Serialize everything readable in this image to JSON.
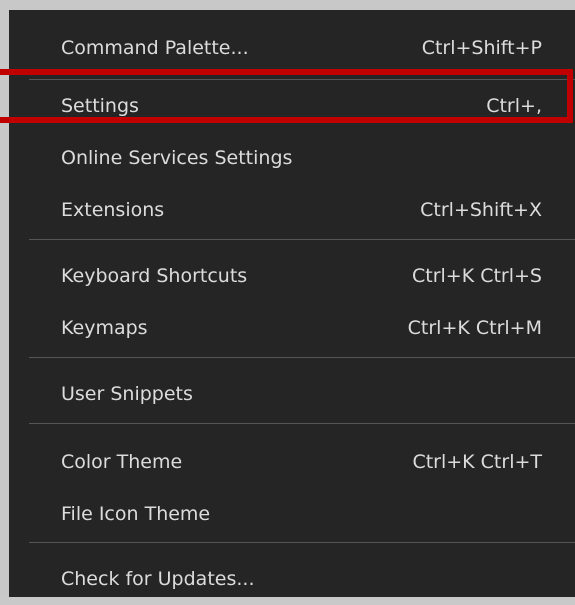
{
  "menu": {
    "items": [
      {
        "label": "Command Palette...",
        "shortcut": "Ctrl+Shift+P"
      },
      {
        "label": "Settings",
        "shortcut": "Ctrl+,"
      },
      {
        "label": "Online Services Settings",
        "shortcut": ""
      },
      {
        "label": "Extensions",
        "shortcut": "Ctrl+Shift+X"
      },
      {
        "label": "Keyboard Shortcuts",
        "shortcut": "Ctrl+K Ctrl+S"
      },
      {
        "label": "Keymaps",
        "shortcut": "Ctrl+K Ctrl+M"
      },
      {
        "label": "User Snippets",
        "shortcut": ""
      },
      {
        "label": "Color Theme",
        "shortcut": "Ctrl+K Ctrl+T"
      },
      {
        "label": "File Icon Theme",
        "shortcut": ""
      },
      {
        "label": "Check for Updates...",
        "shortcut": ""
      }
    ]
  },
  "colors": {
    "menu_background": "#252526",
    "text": "#dcdcdc",
    "separator": "#555555",
    "highlight_border": "#c00000",
    "outer_background": "#c8c8c8"
  }
}
